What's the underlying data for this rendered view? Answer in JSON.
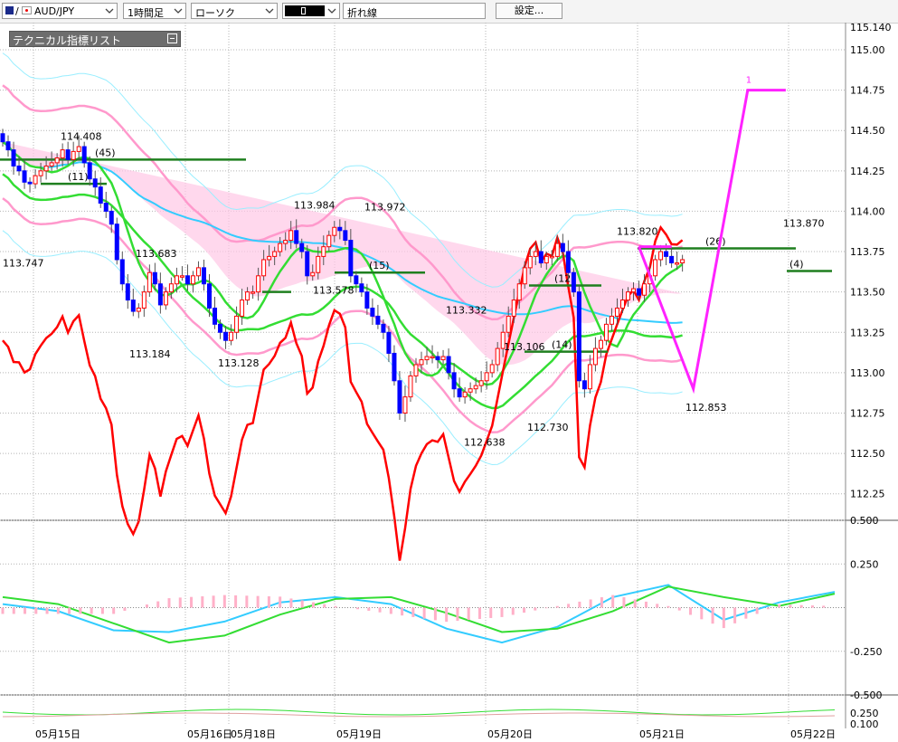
{
  "toolbar": {
    "slash": "/",
    "pair": "AUD/JPY",
    "timeframe": "1時間足",
    "chart_type": "ローソク",
    "line_type": "折れ線",
    "settings": "設定..."
  },
  "indicator_list_label": "テクニカル指標リスト",
  "colors": {
    "bull_candle": "#ff0000",
    "bear_candle": "#0000ff",
    "grid": "#b4b4b4",
    "ma_green": "#33dd33",
    "cyan": "#33ccff",
    "pink": "#ff99cc",
    "red_line": "#ff0000",
    "magenta": "#ff22ff",
    "dark_green": "#1f7f1f"
  },
  "chart_data": [
    {
      "type": "candlestick",
      "symbol": "AUD/JPY",
      "timeframe": "1時間足",
      "ylim": [
        112.125,
        115.14
      ],
      "y_ticks": [
        "115.140",
        "115.00",
        "114.75",
        "114.50",
        "114.25",
        "114.00",
        "113.75",
        "113.50",
        "113.25",
        "113.00",
        "112.75",
        "112.50",
        "112.25"
      ],
      "x_date_labels": [
        "05月15日",
        "05月16日",
        "05月18日",
        "05月19日",
        "05月20日",
        "05月21日",
        "05月22日"
      ],
      "price_annotations": [
        {
          "text": "114.408",
          "value": 114.408
        },
        {
          "text": "113.747",
          "value": 113.747
        },
        {
          "text": "113.683",
          "value": 113.683
        },
        {
          "text": "113.184",
          "value": 113.184
        },
        {
          "text": "113.128",
          "value": 113.128
        },
        {
          "text": "113.984",
          "value": 113.984
        },
        {
          "text": "113.972",
          "value": 113.972
        },
        {
          "text": "113.578",
          "value": 113.578
        },
        {
          "text": "113.332",
          "value": 113.332
        },
        {
          "text": "113.106",
          "value": 113.106
        },
        {
          "text": "112.638",
          "value": 112.638
        },
        {
          "text": "112.730",
          "value": 112.73
        },
        {
          "text": "113.820",
          "value": 113.82
        },
        {
          "text": "112.853",
          "value": 112.853
        },
        {
          "text": "113.870",
          "value": 113.87
        }
      ],
      "level_labels": [
        "(45)",
        "(11)",
        "(15)",
        "(12)",
        "(14)",
        "(26)",
        "(4)",
        "1"
      ],
      "horizontal_levels": [
        {
          "label": "(45)",
          "value": 114.32
        },
        {
          "label": "(11)",
          "value": 114.17
        },
        {
          "label": "",
          "value": 113.5
        },
        {
          "label": "(15)",
          "value": 113.62
        },
        {
          "label": "(12)",
          "value": 113.54
        },
        {
          "label": "(14)",
          "value": 113.13
        },
        {
          "label": "(26)",
          "value": 113.77
        },
        {
          "label": "(4)",
          "value": 113.63
        }
      ],
      "zigzag": [
        {
          "t": 117,
          "v": 113.78
        },
        {
          "t": 127,
          "v": 112.9
        },
        {
          "t": 137,
          "v": 114.75
        },
        {
          "t": 144,
          "v": 114.75
        }
      ],
      "candles": {
        "count": 154,
        "open": [
          114.48,
          114.43,
          114.38,
          114.28,
          114.25,
          114.18,
          114.17,
          114.22,
          114.25,
          114.28,
          114.3,
          114.33,
          114.38,
          114.32,
          114.37,
          114.4,
          114.3,
          114.2,
          114.15,
          114.05,
          114.0,
          113.92,
          113.7,
          113.55,
          113.45,
          113.38,
          113.4,
          113.5,
          113.62,
          113.55,
          113.42,
          113.5,
          113.55,
          113.6,
          113.6,
          113.55,
          113.6,
          113.65,
          113.55,
          113.4,
          113.3,
          113.25,
          113.2,
          113.25,
          113.35,
          113.45,
          113.5,
          113.5,
          113.6,
          113.7,
          113.72,
          113.75,
          113.8,
          113.82,
          113.88,
          113.8,
          113.75,
          113.6,
          113.62,
          113.72,
          113.78,
          113.85,
          113.9,
          113.88,
          113.82,
          113.6,
          113.55,
          113.5,
          113.4,
          113.35,
          113.3,
          113.25,
          113.12,
          112.95,
          112.75,
          112.85,
          112.98,
          113.05,
          113.08,
          113.1,
          113.1,
          113.08,
          113.1,
          113.0,
          112.9,
          112.85,
          112.88,
          112.9,
          112.92,
          112.95,
          113.0,
          113.05,
          113.15,
          113.25,
          113.35,
          113.45,
          113.55,
          113.65,
          113.72,
          113.75,
          113.68,
          113.72,
          113.72,
          113.8,
          113.75,
          113.62,
          113.5,
          112.95,
          112.9,
          113.05,
          113.15,
          113.2,
          113.3,
          113.35,
          113.4,
          113.45,
          113.5,
          113.52,
          113.48,
          113.55,
          113.6,
          113.7,
          113.75,
          113.72,
          113.68,
          113.68
        ],
        "close": [
          114.43,
          114.38,
          114.28,
          114.25,
          114.18,
          114.17,
          114.22,
          114.25,
          114.28,
          114.3,
          114.33,
          114.38,
          114.32,
          114.37,
          114.4,
          114.3,
          114.2,
          114.15,
          114.05,
          114.0,
          113.92,
          113.7,
          113.55,
          113.45,
          113.38,
          113.4,
          113.5,
          113.62,
          113.55,
          113.42,
          113.5,
          113.55,
          113.6,
          113.6,
          113.55,
          113.6,
          113.65,
          113.55,
          113.4,
          113.3,
          113.25,
          113.2,
          113.25,
          113.35,
          113.45,
          113.5,
          113.5,
          113.6,
          113.7,
          113.72,
          113.75,
          113.8,
          113.82,
          113.88,
          113.8,
          113.75,
          113.6,
          113.62,
          113.72,
          113.78,
          113.85,
          113.9,
          113.88,
          113.82,
          113.6,
          113.55,
          113.5,
          113.4,
          113.35,
          113.3,
          113.25,
          113.12,
          112.95,
          112.75,
          112.85,
          112.98,
          113.05,
          113.08,
          113.1,
          113.1,
          113.08,
          113.1,
          113.0,
          112.9,
          112.85,
          112.88,
          112.9,
          112.92,
          112.95,
          113.0,
          113.05,
          113.15,
          113.25,
          113.35,
          113.45,
          113.55,
          113.65,
          113.72,
          113.75,
          113.68,
          113.72,
          113.72,
          113.8,
          113.75,
          113.62,
          113.5,
          112.95,
          112.9,
          113.05,
          113.15,
          113.2,
          113.3,
          113.35,
          113.4,
          113.45,
          113.5,
          113.52,
          113.48,
          113.55,
          113.6,
          113.7,
          113.75,
          113.72,
          113.68,
          113.68,
          113.7
        ]
      }
    },
    {
      "type": "line",
      "name": "MACD",
      "ylim": [
        -0.5,
        0.5
      ],
      "y_ticks": [
        "0.500",
        "0.250",
        "-0.250",
        "-0.500"
      ],
      "x": [
        0,
        10,
        20,
        30,
        40,
        50,
        60,
        70,
        80,
        90,
        100,
        110,
        120,
        130,
        140,
        150
      ],
      "series": [
        {
          "name": "",
          "values": [
            0.02,
            -0.02,
            -0.13,
            -0.14,
            -0.08,
            0.03,
            0.06,
            0.02,
            -0.12,
            -0.2,
            -0.11,
            0.06,
            0.13,
            -0.07,
            0.03,
            0.09
          ]
        },
        {
          "name": "",
          "values": [
            0.06,
            0.02,
            -0.09,
            -0.2,
            -0.16,
            -0.04,
            0.05,
            0.06,
            -0.03,
            -0.14,
            -0.12,
            -0.02,
            0.12,
            0.06,
            0.01,
            0.08
          ]
        }
      ]
    },
    {
      "type": "line",
      "name": "",
      "ylim": [
        0.1,
        0.5
      ],
      "y_ticks": [
        "0.250",
        "0.100"
      ]
    }
  ]
}
